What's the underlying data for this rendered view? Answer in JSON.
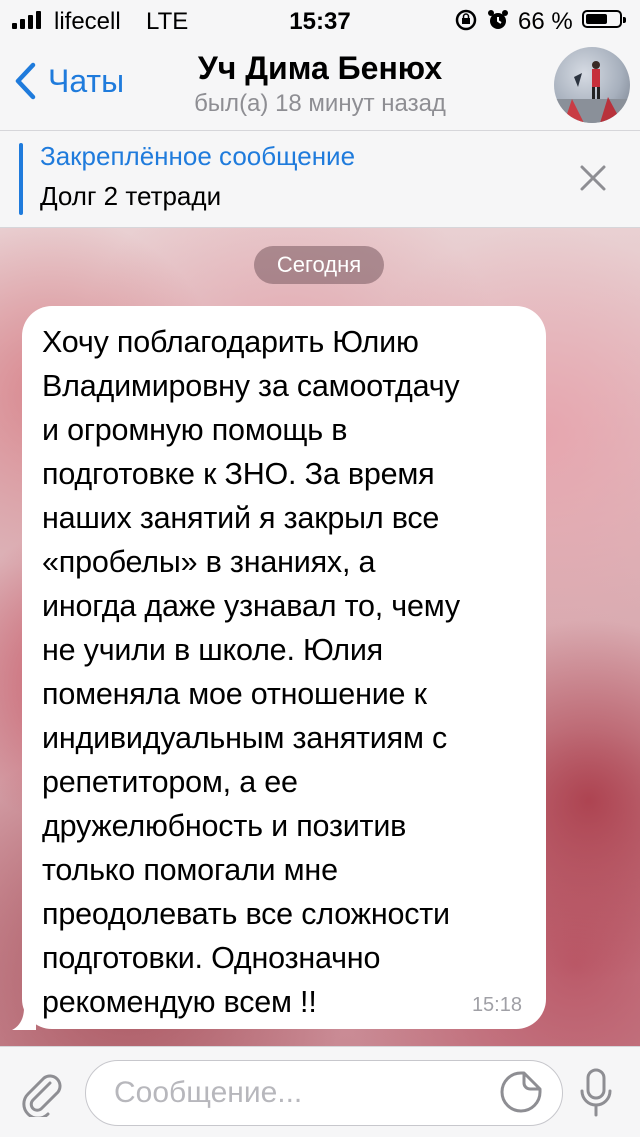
{
  "status_bar": {
    "carrier": "lifecell",
    "network": "LTE",
    "time": "15:37",
    "battery_percent": "66 %",
    "battery_level": 0.66
  },
  "header": {
    "back_label": "Чаты",
    "title": "Уч Дима Бенюх",
    "subtitle": "был(а) 18 минут назад"
  },
  "pinned": {
    "title": "Закреплённое сообщение",
    "text": "Долг 2 тетради"
  },
  "chat": {
    "date_label": "Сегодня",
    "messages": [
      {
        "text": "Хочу поблагодарить Юлию\nВладимировну за самоотдачу\nи огромную помощь в\nподготовке к ЗНО. За время\nнаших занятий я закрыл все\n«пробелы» в знаниях, а\nиногда даже узнавал то, чему\nне учили в школе. Юлия\nпоменяла мое отношение к\nиндивидуальным занятиям с\nрепетитором, а ее\nдружелюбность и позитив\nтолько помогали мне\nпреодолевать все сложности\nподготовки. Однозначно\nрекомендую всем !!",
        "time": "15:18"
      }
    ]
  },
  "input_bar": {
    "placeholder": "Сообщение..."
  },
  "colors": {
    "accent": "#1f7bdc",
    "secondary_text": "#8e8e93"
  },
  "icons": [
    "signal-icon",
    "alarm-lock-icon",
    "alarm-clock-icon",
    "battery-icon",
    "back-chevron-icon",
    "close-icon",
    "attach-paperclip-icon",
    "sticker-icon",
    "microphone-icon"
  ]
}
